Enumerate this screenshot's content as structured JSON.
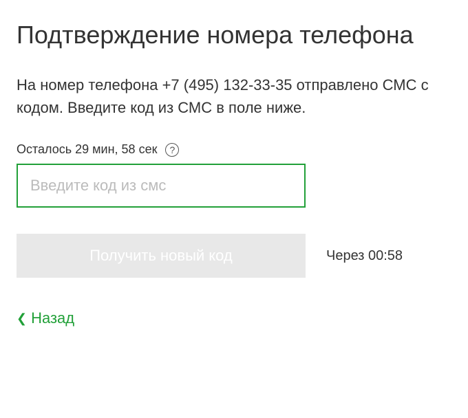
{
  "header": {
    "title": "Подтверждение номера телефона"
  },
  "instruction": {
    "text": "На номер телефона +7 (495) 132-33-35 отправлено СМС с кодом. Введите код из СМС в поле ниже."
  },
  "timer": {
    "text": "Осталось 29 мин, 58 сек"
  },
  "code_input": {
    "placeholder": "Введите код из смс",
    "value": ""
  },
  "new_code_button": {
    "label": "Получить новый код"
  },
  "countdown": {
    "text": "Через 00:58"
  },
  "back_link": {
    "label": "Назад"
  },
  "colors": {
    "accent": "#21a038"
  }
}
